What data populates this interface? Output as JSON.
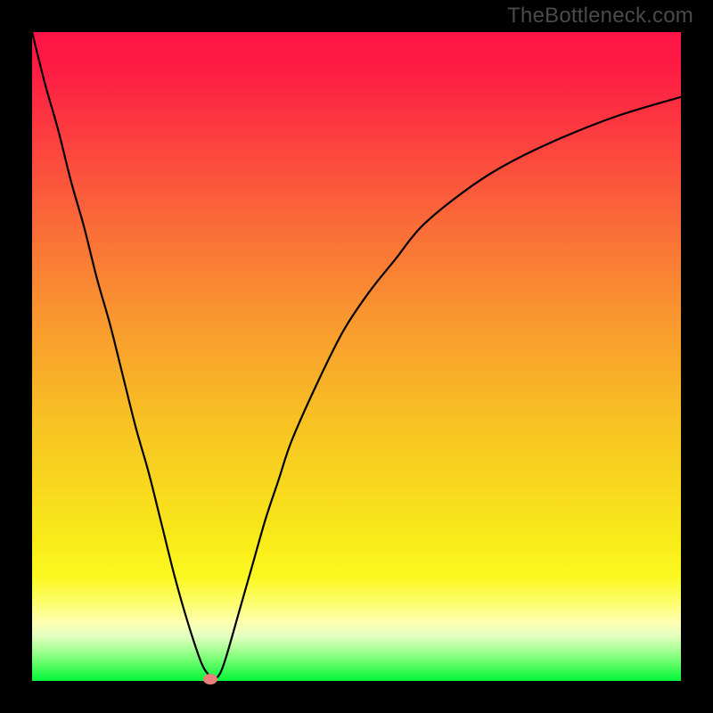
{
  "branding": {
    "watermark": "TheBottleneck.com"
  },
  "chart_data": {
    "type": "line",
    "title": "",
    "xlabel": "",
    "ylabel": "",
    "xlim": [
      0,
      100
    ],
    "ylim": [
      0,
      100
    ],
    "grid": false,
    "legend": false,
    "background_gradient": {
      "top_color": "#fd1446",
      "bottom_color": "#04f636",
      "note": "maps low y values (bottom) to green / good, high y values (top) to red / bad"
    },
    "series": [
      {
        "name": "bottleneck-curve",
        "color": "#000000",
        "x": [
          0,
          2,
          4,
          6,
          8,
          10,
          12,
          14,
          16,
          18,
          20,
          22,
          24,
          26,
          27,
          28,
          29,
          30,
          32,
          34,
          36,
          38,
          40,
          44,
          48,
          52,
          56,
          60,
          66,
          72,
          80,
          90,
          100
        ],
        "y": [
          100,
          92,
          85,
          77,
          70,
          62,
          55,
          47,
          39,
          32,
          24,
          16,
          9,
          3,
          1.2,
          0.3,
          1.2,
          4,
          11,
          18,
          25,
          31,
          37,
          46,
          54,
          60,
          65,
          70,
          75,
          79,
          83,
          87,
          90
        ]
      }
    ],
    "marker": {
      "name": "optimal-point",
      "x": 27.5,
      "y": 0.3,
      "color": "#e98079"
    }
  }
}
